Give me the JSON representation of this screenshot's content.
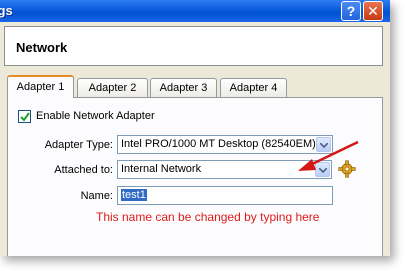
{
  "window": {
    "title": "ings"
  },
  "title_buttons": {
    "help": "?",
    "close": "✕"
  },
  "header": {
    "title": "Network"
  },
  "tabs": [
    {
      "label": "Adapter 1",
      "active": true
    },
    {
      "label": "Adapter 2",
      "active": false
    },
    {
      "label": "Adapter 3",
      "active": false
    },
    {
      "label": "Adapter 4",
      "active": false
    }
  ],
  "form": {
    "enable_label": "Enable Network Adapter",
    "enable_checked": true,
    "adapter_type_label": "Adapter Type:",
    "adapter_type_value": "Intel PRO/1000 MT Desktop (82540EM)",
    "attached_label": "Attached to:",
    "attached_value": "Internal Network",
    "name_label": "Name:",
    "name_value": "test1"
  },
  "annotation": {
    "text": "This name can be changed by typing here",
    "color": "#e01b1b"
  },
  "icons": [
    "help-icon",
    "close-icon",
    "check-icon",
    "dropdown-arrow-icon",
    "gear-icon",
    "red-arrow-icon"
  ]
}
